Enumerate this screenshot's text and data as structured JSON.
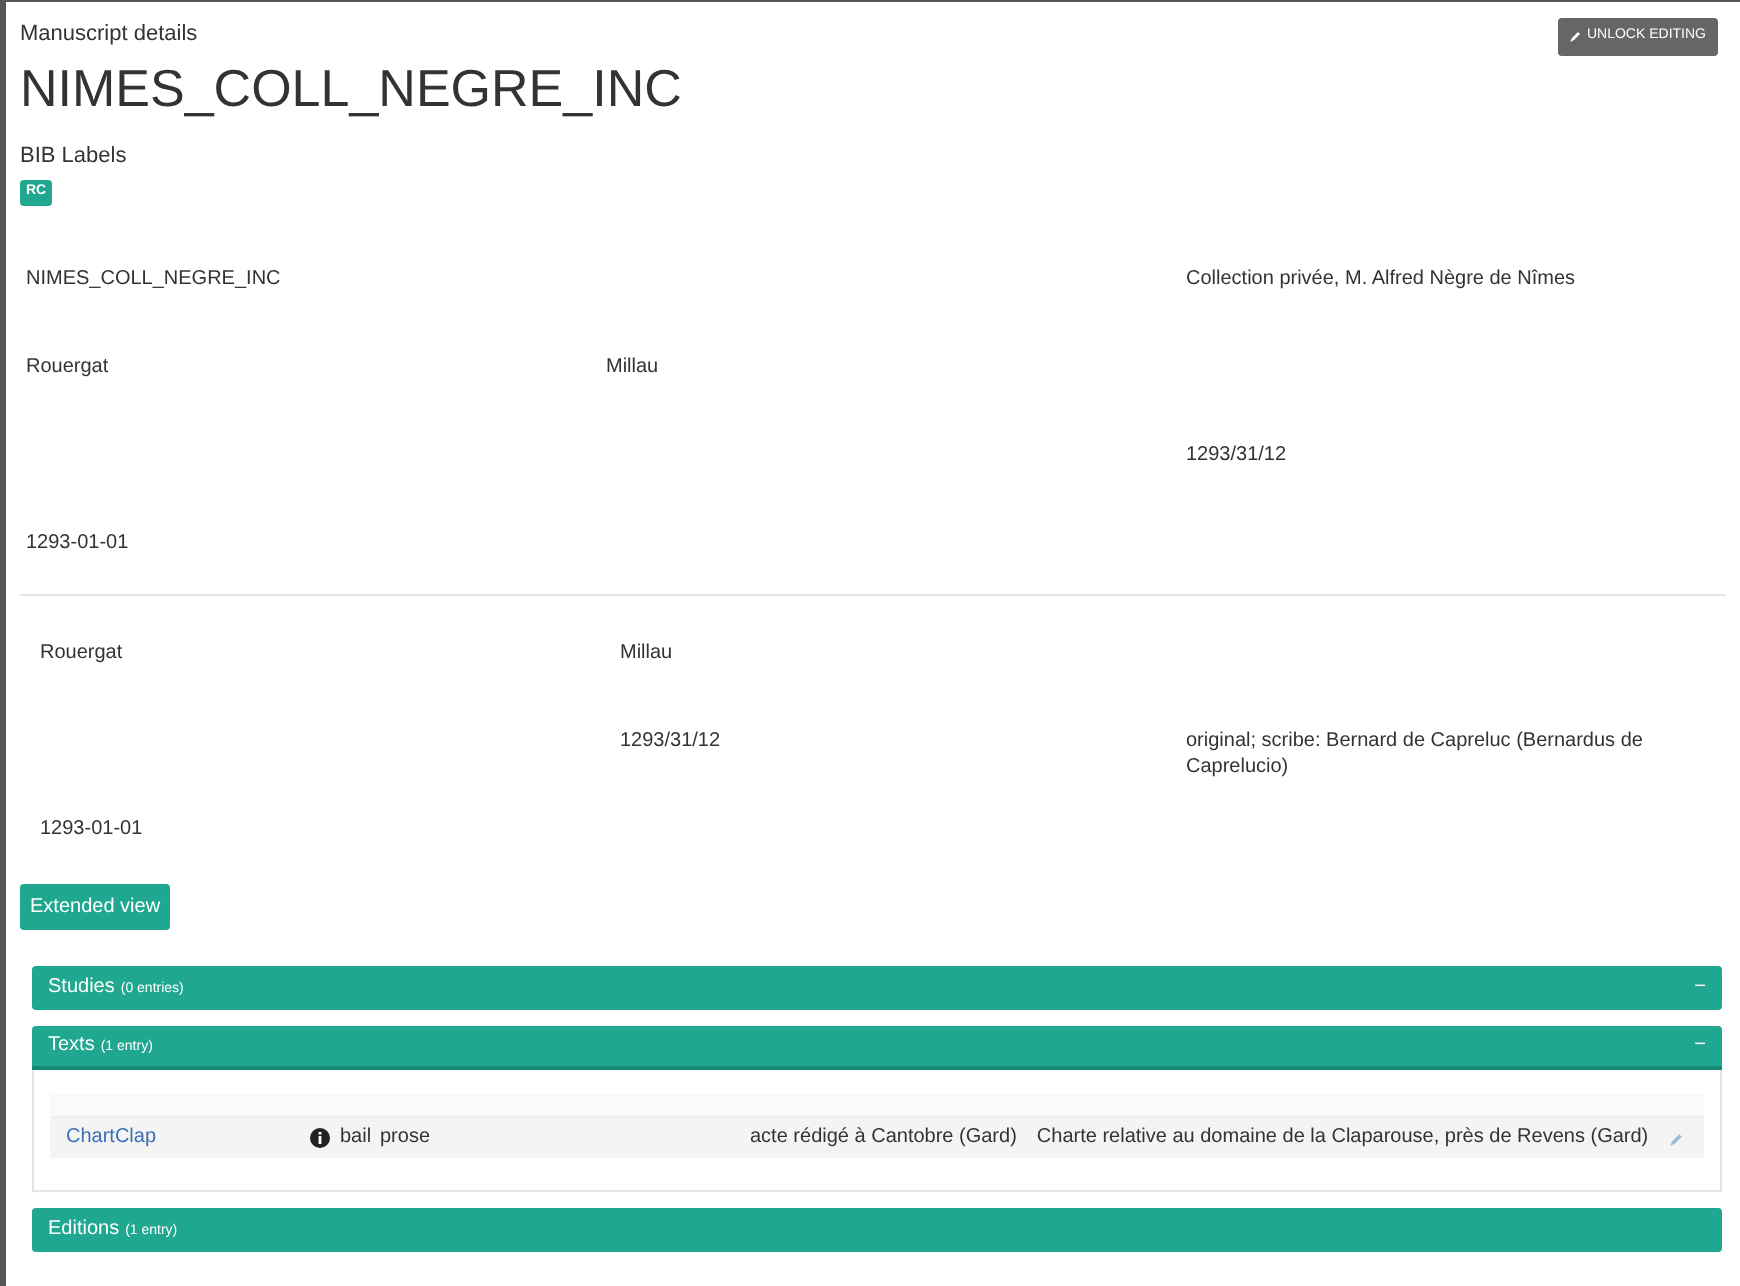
{
  "header": {
    "caption": "Manuscript details",
    "title": "NIMES_COLL_NEGRE_INC",
    "unlock_button": "UNLOCK EDITING"
  },
  "bib_labels": {
    "title": "BIB Labels",
    "tags": [
      "RC"
    ]
  },
  "main_fields": [
    {
      "column_1": "NIMES_COLL_NEGRE_INC",
      "column_3": "Collection privée, M. Alfred Nègre de Nîmes"
    },
    {
      "column_1": "Rouergat",
      "column_2": "Millau"
    },
    {
      "column_3": "1293/31/12"
    },
    {
      "column_1": "1293-01-01"
    }
  ],
  "sub_fields": [
    {
      "column_1": "Rouergat",
      "column_2": "Millau"
    },
    {
      "column_2": "1293/31/12",
      "column_3": "original; scribe: Bernard de Capreluc (Bernardus de Caprelucio)"
    },
    {
      "column_1": "1293-01-01"
    }
  ],
  "extended_view_button": "Extended view",
  "sections": [
    {
      "title": "Studies",
      "count": "(0 entries)",
      "toggle": "−",
      "expanded": false
    },
    {
      "title": "Texts",
      "count": "(1 entry)",
      "toggle": "−",
      "expanded": true,
      "rows": [
        {
          "siglum": "ChartClap",
          "genre": "bail",
          "form": "prose",
          "comment": "acte rédigé à Cantobre (Gard)",
          "title": "Charte relative au domaine de la Claparouse, près de Revens (Gard)"
        }
      ]
    },
    {
      "title": "Editions",
      "count": "(1 entry)",
      "expanded": false
    }
  ]
}
